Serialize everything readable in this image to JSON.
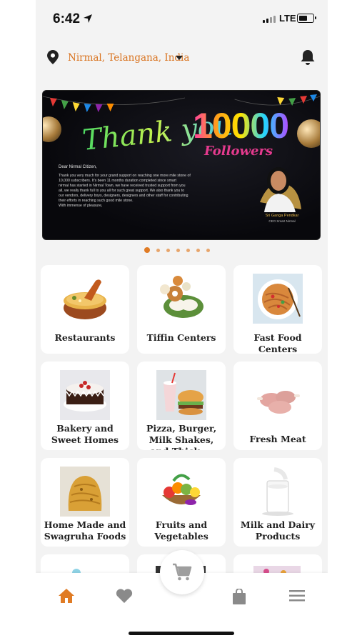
{
  "status_bar": {
    "time": "6:42",
    "network": "LTE",
    "icons": [
      "location-arrow-icon",
      "signal-icon",
      "battery-icon"
    ]
  },
  "header": {
    "location": "Nirmal, Telangana, India",
    "icons": [
      "map-pin-icon",
      "caret-down-icon",
      "bell-icon"
    ]
  },
  "banner": {
    "thank_you": "Thank you",
    "count": "10000",
    "followers": "Followers",
    "greeting": "Dear Nirmal Citizen,",
    "letter_lines": [
      "Thank you very much for your grand support on reaching one more mile stone of",
      "10,000 subscribers. It's been 11 months duration completed since smart",
      "nirmal has started in Nirmal Town, we have received trusted support from you",
      "all, we really thank full to you all for such great support. We also thank you to",
      "our vendors, delivery boys, designers, designers and other staff for contributing",
      "their efforts in reaching such good mile stone.",
      "With immense of pleasure,"
    ],
    "signatory": "Sri Ganga Pendkar",
    "signatory_title": "CEO Smart Nirmal"
  },
  "carousel": {
    "total": 7,
    "active": 0
  },
  "categories": [
    {
      "label": "Restaurants",
      "icon": "biryani-icon"
    },
    {
      "label": "Tiffin Centers",
      "icon": "idli-vada-icon"
    },
    {
      "label": "Fast Food Centers",
      "icon": "noodles-icon"
    },
    {
      "label": "Bakery and Sweet Homes",
      "icon": "cake-icon"
    },
    {
      "label": "Pizza, Burger, Milk Shakes, and Thick ...",
      "icon": "burger-shake-icon"
    },
    {
      "label": "Fresh Meat",
      "icon": "chicken-legs-icon"
    },
    {
      "label": "Home Made and Swagruha Foods",
      "icon": "snacks-icon"
    },
    {
      "label": "Fruits and Vegetables",
      "icon": "fruit-basket-icon"
    },
    {
      "label": "Milk and Dairy Products",
      "icon": "milk-glass-icon"
    }
  ],
  "bottom_nav": {
    "items": [
      "home-icon",
      "heart-icon",
      "cart-icon",
      "bag-icon",
      "menu-icon"
    ],
    "active": "home-icon"
  },
  "colors": {
    "accent": "#e07b24",
    "location_text": "#d9731f",
    "background": "#f3f3f3"
  }
}
